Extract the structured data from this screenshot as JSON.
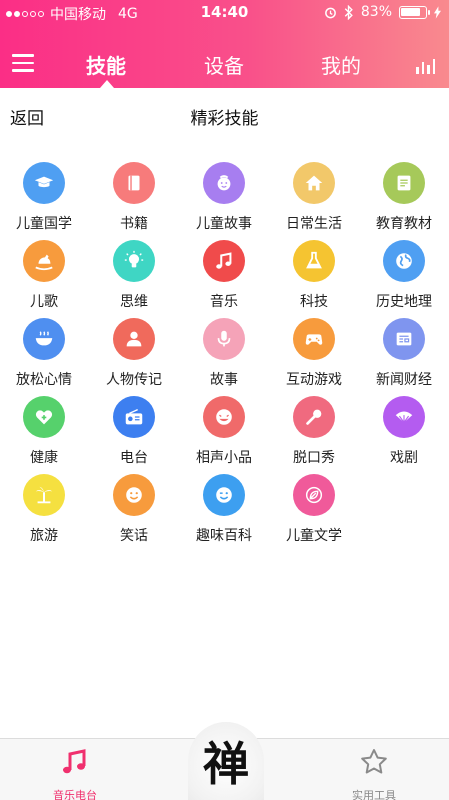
{
  "status": {
    "carrier": "中国移动",
    "network": "4G",
    "time": "14:40",
    "battery": "83%",
    "battery_level": 0.83
  },
  "nav": {
    "tabs": [
      {
        "label": "技能"
      },
      {
        "label": "设备"
      },
      {
        "label": "我的"
      }
    ],
    "active_tab": "技能"
  },
  "subheader": {
    "back_label": "返回",
    "title": "精彩技能"
  },
  "skills": [
    {
      "label": "儿童国学",
      "color": "#4f9ff2",
      "icon": "graduation-cap-icon"
    },
    {
      "label": "书籍",
      "color": "#f77b7b",
      "icon": "book-icon"
    },
    {
      "label": "儿童故事",
      "color": "#a77ef0",
      "icon": "child-face-icon"
    },
    {
      "label": "日常生活",
      "color": "#f2c86a",
      "icon": "house-icon"
    },
    {
      "label": "教育教材",
      "color": "#a6c95a",
      "icon": "textbook-icon"
    },
    {
      "label": "儿歌",
      "color": "#f79b3d",
      "icon": "rocking-horse-icon"
    },
    {
      "label": "思维",
      "color": "#3fd6c4",
      "icon": "lightbulb-icon"
    },
    {
      "label": "音乐",
      "color": "#f04b4b",
      "icon": "music-note-icon"
    },
    {
      "label": "科技",
      "color": "#f5c431",
      "icon": "flask-icon"
    },
    {
      "label": "历史地理",
      "color": "#4f9ff2",
      "icon": "globe-icon"
    },
    {
      "label": "放松心情",
      "color": "#4f8ff0",
      "icon": "bowl-icon"
    },
    {
      "label": "人物传记",
      "color": "#f06a5c",
      "icon": "person-icon"
    },
    {
      "label": "故事",
      "color": "#f5a3b8",
      "icon": "microphone-icon"
    },
    {
      "label": "互动游戏",
      "color": "#f79b3d",
      "icon": "gamepad-icon"
    },
    {
      "label": "新闻财经",
      "color": "#7f95ef",
      "icon": "newspaper-icon"
    },
    {
      "label": "健康",
      "color": "#56d16c",
      "icon": "health-heart-icon"
    },
    {
      "label": "电台",
      "color": "#3d7ff0",
      "icon": "radio-icon"
    },
    {
      "label": "相声小品",
      "color": "#f06a6a",
      "icon": "laughing-face-icon"
    },
    {
      "label": "脱口秀",
      "color": "#f06a7f",
      "icon": "handheld-mic-icon"
    },
    {
      "label": "戏剧",
      "color": "#b45cf0",
      "icon": "fan-icon"
    },
    {
      "label": "旅游",
      "color": "#f5e040",
      "icon": "palm-tree-icon"
    },
    {
      "label": "笑话",
      "color": "#f79b3d",
      "icon": "smiley-icon"
    },
    {
      "label": "趣味百科",
      "color": "#3d9ff0",
      "icon": "wink-face-icon"
    },
    {
      "label": "儿童文学",
      "color": "#f05a9a",
      "icon": "leaf-icon"
    }
  ],
  "bottom_bar": {
    "left_label": "音乐电台",
    "right_label": "实用工具",
    "center_glyph": "禅",
    "active_color": "#f0306e",
    "inactive_color": "#888888"
  }
}
